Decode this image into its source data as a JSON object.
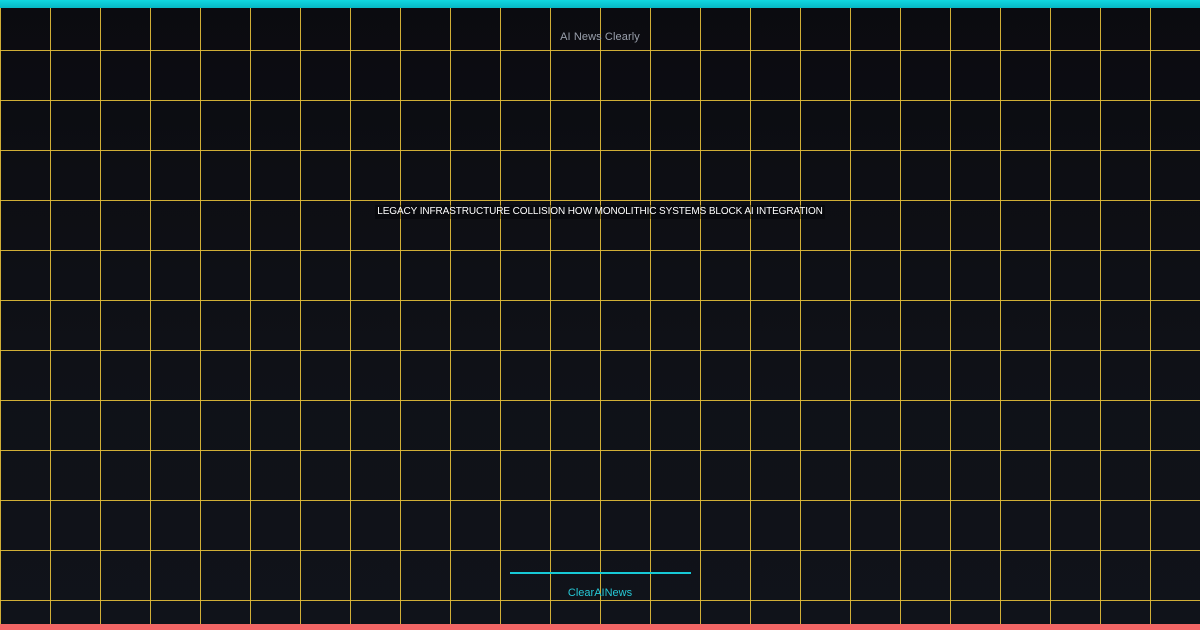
{
  "header": {
    "brand_text": "AI News Clearly"
  },
  "main": {
    "headline": "LEGACY INFRASTRUCTURE COLLISION HOW MONOLITHIC SYSTEMS BLOCK AI INTEGRATION"
  },
  "footer": {
    "brand_text": "ClearAINews"
  },
  "colors": {
    "background": "#0e0f14",
    "grid": "#e6c03a",
    "top_accent": "#10d8e0",
    "bottom_accent": "#f26666",
    "footer_accent": "#17c9d6"
  }
}
